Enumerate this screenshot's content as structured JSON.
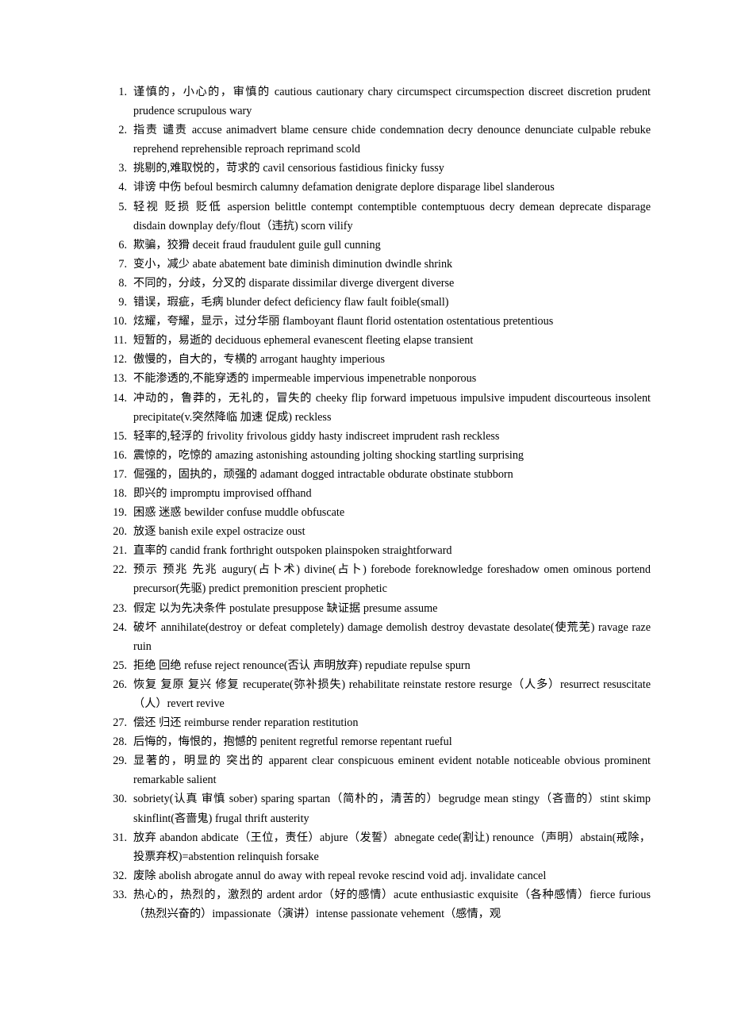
{
  "document": {
    "type": "vocabulary-synonym-list",
    "language": "zh-en",
    "background_color": "#ffffff",
    "text_color": "#000000",
    "total_items": 33
  },
  "items": [
    {
      "number": "1.",
      "chinese": "谨慎的，小心的，审慎的",
      "english": "cautious cautionary chary circumspect circumspection",
      "english_after_gap": "discreet discretion prudent prudence scrupulous wary",
      "has_wide_gap": true,
      "text": "谨慎的，小心的，审慎的  cautious cautionary chary circumspect circumspection            discreet discretion prudent prudence scrupulous wary"
    },
    {
      "number": "2.",
      "chinese": "指责 谴责",
      "english": "accuse animadvert blame censure chide condemnation decry denounce denunciate culpable rebuke reprehend reprehensible reproach reprimand scold",
      "text": "指责 谴责  accuse animadvert blame censure chide condemnation decry denounce denunciate culpable rebuke reprehend reprehensible reproach reprimand scold"
    },
    {
      "number": "3.",
      "chinese": "挑剔的,难取悦的，苛求的",
      "english": "cavil censorious fastidious finicky fussy",
      "text": "挑剔的,难取悦的，苛求的  cavil censorious fastidious finicky fussy"
    },
    {
      "number": "4.",
      "chinese": "诽谤 中伤",
      "english": "befoul besmirch calumny defamation denigrate deplore disparage libel slanderous",
      "text": "诽谤 中伤  befoul besmirch calumny defamation denigrate deplore disparage libel slanderous"
    },
    {
      "number": "5.",
      "chinese": "轻视 贬损 贬低",
      "english": "aspersion belittle contempt contemptible contemptuous decry demean deprecate disparage disdain downplay defy/flout（违抗) scorn vilify",
      "text": "轻视 贬损 贬低  aspersion belittle contempt contemptible contemptuous decry demean deprecate disparage disdain downplay defy/flout（违抗) scorn vilify"
    },
    {
      "number": "6.",
      "chinese": "欺骗，狡猾",
      "english": "deceit fraud fraudulent guile gull cunning",
      "text": "欺骗，狡猾  deceit fraud fraudulent guile gull cunning"
    },
    {
      "number": "7.",
      "chinese": "变小，减少",
      "english": "abate abatement bate diminish diminution dwindle shrink",
      "text": "变小，减少  abate abatement bate diminish diminution dwindle shrink"
    },
    {
      "number": "8.",
      "chinese": "不同的，分歧，分叉的",
      "english": "disparate dissimilar diverge divergent diverse",
      "text": "不同的，分歧，分叉的  disparate dissimilar diverge divergent diverse"
    },
    {
      "number": "9.",
      "chinese": "错误，瑕疵，毛病",
      "english": "blunder defect deficiency flaw fault foible(small)",
      "text": "错误，瑕疵，毛病  blunder defect deficiency flaw fault foible(small)"
    },
    {
      "number": "10.",
      "chinese": "炫耀，夸耀，显示，过分华丽",
      "english": "flamboyant flaunt florid ostentation ostentatious pretentious",
      "text": "炫耀，夸耀，显示，过分华丽  flamboyant flaunt florid ostentation ostentatious pretentious"
    },
    {
      "number": "11.",
      "chinese": "短暂的，易逝的",
      "english": "deciduous ephemeral evanescent fleeting elapse transient",
      "text": "短暂的，易逝的  deciduous ephemeral evanescent fleeting elapse transient"
    },
    {
      "number": "12.",
      "chinese": "傲慢的，自大的，专横的",
      "english": "arrogant haughty imperious",
      "text": "傲慢的，自大的，专横的  arrogant haughty imperious"
    },
    {
      "number": "13.",
      "chinese": "不能渗透的,不能穿透的",
      "english": "impermeable impervious impenetrable nonporous",
      "text": "不能渗透的,不能穿透的  impermeable impervious impenetrable nonporous"
    },
    {
      "number": "14.",
      "chinese": "冲动的，鲁莽的，无礼的，冒失的",
      "english": "cheeky flip forward impetuous impulsive impudent discourteous insolent precipitate(v.突然降临 加速 促成) reckless",
      "text": "冲动的，鲁莽的，无礼的，冒失的 cheeky flip forward impetuous impulsive impudent discourteous insolent precipitate(v.突然降临 加速 促成) reckless"
    },
    {
      "number": "15.",
      "chinese": "轻率的,轻浮的",
      "english": "frivolity frivolous giddy hasty indiscreet imprudent rash reckless",
      "text": "轻率的,轻浮的  frivolity frivolous giddy hasty indiscreet imprudent rash reckless"
    },
    {
      "number": "16.",
      "chinese": "震惊的，吃惊的",
      "english": "amazing astonishing astounding jolting shocking startling surprising",
      "text": "震惊的，吃惊的  amazing astonishing astounding jolting shocking startling surprising"
    },
    {
      "number": "17.",
      "chinese": "倔强的，固执的，顽强的",
      "english": "adamant dogged intractable obdurate obstinate stubborn",
      "text": "倔强的，固执的，顽强的  adamant dogged intractable obdurate obstinate stubborn"
    },
    {
      "number": "18.",
      "chinese": "即兴的",
      "english": "impromptu improvised offhand",
      "text": "即兴的  impromptu improvised offhand"
    },
    {
      "number": "19.",
      "chinese": "困惑 迷惑",
      "english": "bewilder confuse muddle obfuscate",
      "text": "困惑 迷惑 bewilder confuse muddle obfuscate"
    },
    {
      "number": "20.",
      "chinese": "放逐",
      "english": "banish exile expel ostracize oust",
      "text": "放逐  banish exile expel ostracize oust"
    },
    {
      "number": "21.",
      "chinese": "直率的",
      "english": "candid frank forthright outspoken plainspoken straightforward",
      "text": "直率的  candid frank forthright outspoken plainspoken straightforward"
    },
    {
      "number": "22.",
      "chinese": "预示 预兆 先兆",
      "english": "augury(占卜术) divine(占卜) forebode foreknowledge foreshadow omen ominous portend precursor(先驱) predict premonition prescient prophetic",
      "text": "预示 预兆 先兆  augury(占卜术) divine(占卜) forebode foreknowledge foreshadow omen ominous portend precursor(先驱) predict premonition prescient prophetic"
    },
    {
      "number": "23.",
      "chinese": "假定 以为先决条件",
      "english": "postulate presuppose   缺证据 presume assume",
      "text": "假定 以为先决条件  postulate presuppose   缺证据 presume assume"
    },
    {
      "number": "24.",
      "chinese": "破坏",
      "english": "annihilate(destroy or defeat completely) damage demolish destroy devastate desolate(使荒芜) ravage raze ruin",
      "text": "破坏  annihilate(destroy or defeat completely) damage demolish destroy devastate desolate(使荒芜) ravage raze ruin"
    },
    {
      "number": "25.",
      "chinese": "拒绝 回绝",
      "english": "refuse reject renounce(否认 声明放弃) repudiate repulse spurn",
      "text": "拒绝 回绝  refuse reject renounce(否认 声明放弃) repudiate repulse spurn"
    },
    {
      "number": "26.",
      "chinese": "恢复 复原 复兴 修复",
      "english": "recuperate(弥补损失) rehabilitate reinstate restore resurge（人多）resurrect resuscitate（人）revert revive",
      "text": "恢复 复原 复兴 修复  recuperate(弥补损失) rehabilitate reinstate restore resurge（人多）resurrect resuscitate（人）revert revive"
    },
    {
      "number": "27.",
      "chinese": "偿还 归还",
      "english": "reimburse render reparation restitution",
      "text": "偿还 归还  reimburse render reparation restitution"
    },
    {
      "number": "28.",
      "chinese": "后悔的，悔恨的，抱憾的",
      "english": "penitent regretful remorse repentant rueful",
      "text": "后悔的，悔恨的，抱憾的  penitent regretful remorse repentant rueful"
    },
    {
      "number": "29.",
      "chinese": "显著的，明显的 突出的",
      "english": "apparent clear conspicuous eminent evident notable noticeable obvious prominent remarkable salient",
      "text": "显著的，明显的 突出的  apparent clear conspicuous eminent evident notable noticeable obvious prominent remarkable salient"
    },
    {
      "number": "30.",
      "chinese": "",
      "english": "sobriety(认真 审慎 sober) sparing spartan（简朴的，清苦的）begrudge mean stingy（吝啬的）stint skimp skinflint(吝啬鬼) frugal thrift austerity",
      "text": "sobriety(认真 审慎 sober) sparing spartan（简朴的，清苦的）begrudge mean stingy（吝啬的）stint skimp skinflint(吝啬鬼) frugal thrift austerity"
    },
    {
      "number": "31.",
      "chinese": "放弃",
      "english": "abandon abdicate（王位，责任）abjure（发誓）abnegate cede(割让) renounce（声明）abstain(戒除，投票弃权)=abstention relinquish forsake",
      "text": "放弃  abandon abdicate（王位，责任）abjure（发誓）abnegate cede(割让) renounce（声明）abstain(戒除，投票弃权)=abstention relinquish forsake"
    },
    {
      "number": "32.",
      "chinese": "废除",
      "english": "abolish abrogate annul do away with repeal revoke rescind void adj. invalidate cancel",
      "text": "废除  abolish abrogate annul do away with repeal revoke rescind void adj. invalidate cancel"
    },
    {
      "number": "33.",
      "chinese": "热心的，热烈的，激烈的",
      "english": "ardent ardor（好的感情）acute enthusiastic exquisite（各种感情）fierce furious（热烈兴奋的）impassionate（演讲）intense passionate vehement（感情，观",
      "text": "热心的，热烈的，激烈的  ardent ardor（好的感情）acute enthusiastic exquisite（各种感情）fierce furious（热烈兴奋的）impassionate（演讲）intense passionate vehement（感情，观"
    }
  ]
}
